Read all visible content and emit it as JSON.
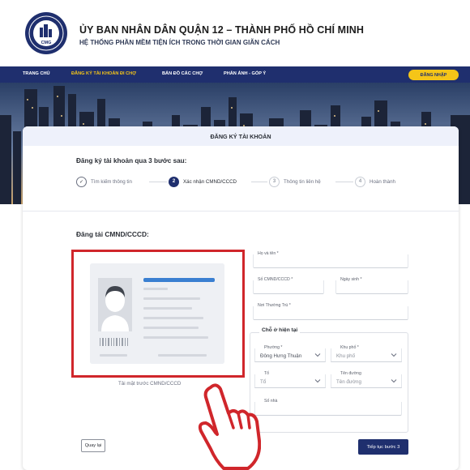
{
  "header": {
    "title": "ỦY BAN NHÂN DÂN QUẬN 12 – THÀNH PHỐ HỒ CHÍ MINH",
    "subtitle": "HỆ THỐNG PHẦN MỀM TIỆN ÍCH TRONG THỜI GIAN GIÃN CÁCH",
    "logo_text": "CMG"
  },
  "nav": {
    "items": [
      {
        "label": "TRANG CHỦ"
      },
      {
        "label": "ĐĂNG KÝ TÀI KHOẢN ĐI CHỢ"
      },
      {
        "label": "BẢN ĐỒ CÁC CHỢ"
      },
      {
        "label": "PHẢN ÁNH - GÓP Ý"
      }
    ],
    "active_index": 1,
    "login_label": "ĐĂNG NHẬP"
  },
  "card": {
    "title": "ĐĂNG KÝ TÀI KHOẢN",
    "steps_intro": "Đăng ký tài khoản qua 3 bước sau:",
    "steps": [
      {
        "badge": "✓",
        "label": "Tìm kiếm thông tin",
        "state": "done"
      },
      {
        "badge": "2",
        "label": "Xác nhận CMND/CCCD",
        "state": "current"
      },
      {
        "badge": "3",
        "label": "Thông tin liên hệ",
        "state": "todo"
      },
      {
        "badge": "4",
        "label": "Hoàn thành",
        "state": "todo"
      }
    ]
  },
  "upload": {
    "heading": "Đăng tải CMND/CCCD:",
    "caption": "Tải mặt trước CMND/CCCD"
  },
  "form": {
    "full_name_label": "Họ và tên *",
    "id_number_label": "Số CMND/CCCD *",
    "dob_label": "Ngày sinh *",
    "permanent_address_label": "Nơi Thường Trú *",
    "current_address_title": "Chỗ ở hiện tại",
    "ward_label": "Phường *",
    "ward_value": "Đông Hưng Thuận",
    "quarter_label": "Khu phố *",
    "quarter_placeholder": "Khu phố",
    "group_label": "Tổ",
    "group_placeholder": "Tổ",
    "street_label": "Tên đường",
    "street_placeholder": "Tên đường",
    "house_number_label": "Số nhà"
  },
  "actions": {
    "back_label": "Quay lại",
    "next_label": "Tiếp tục bước 3"
  },
  "colors": {
    "navy": "#1f2f6e",
    "accent_yellow": "#f5c518",
    "highlight_red": "#d0262b"
  }
}
